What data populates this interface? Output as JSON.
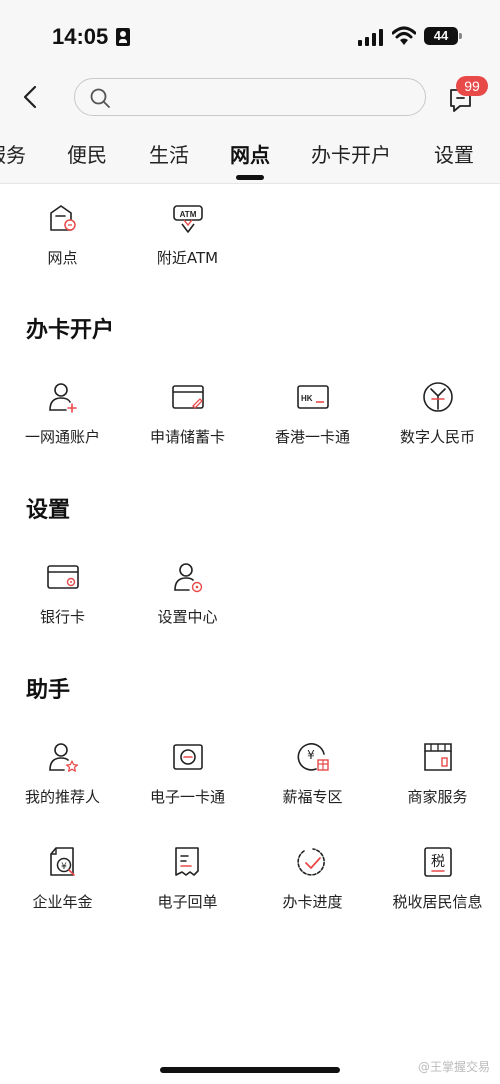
{
  "status_bar": {
    "time": "14:05",
    "battery": "44"
  },
  "header": {
    "search_placeholder": "",
    "badge_count": "99"
  },
  "tabs": [
    {
      "label": "服务"
    },
    {
      "label": "便民"
    },
    {
      "label": "生活"
    },
    {
      "label": "网点"
    },
    {
      "label": "办卡开户"
    },
    {
      "label": "设置"
    }
  ],
  "branch_section": {
    "items": [
      {
        "label": "网点",
        "icon": "bank-branch-icon"
      },
      {
        "label": "附近ATM",
        "icon": "atm-location-icon"
      }
    ]
  },
  "card_section": {
    "title": "办卡开户",
    "items": [
      {
        "label": "一网通账户",
        "icon": "user-add-icon"
      },
      {
        "label": "申请储蓄卡",
        "icon": "card-apply-icon"
      },
      {
        "label": "香港一卡通",
        "icon": "hk-card-icon"
      },
      {
        "label": "数字人民币",
        "icon": "digital-rmb-icon"
      }
    ]
  },
  "settings_section": {
    "title": "设置",
    "items": [
      {
        "label": "银行卡",
        "icon": "bank-card-icon"
      },
      {
        "label": "设置中心",
        "icon": "user-settings-icon"
      }
    ]
  },
  "assistant_section": {
    "title": "助手",
    "items": [
      {
        "label": "我的推荐人",
        "icon": "referrer-icon"
      },
      {
        "label": "电子一卡通",
        "icon": "e-card-icon"
      },
      {
        "label": "薪福专区",
        "icon": "salary-icon"
      },
      {
        "label": "商家服务",
        "icon": "merchant-icon"
      },
      {
        "label": "企业年金",
        "icon": "annuity-icon"
      },
      {
        "label": "电子回单",
        "icon": "e-receipt-icon"
      },
      {
        "label": "办卡进度",
        "icon": "progress-icon"
      },
      {
        "label": "税收居民信息",
        "icon": "tax-icon"
      }
    ]
  },
  "watermark": "@王掌握交易",
  "colors": {
    "accent": "#e84a4a",
    "background": "#ffffff",
    "header_bg": "#f7f7f7"
  }
}
